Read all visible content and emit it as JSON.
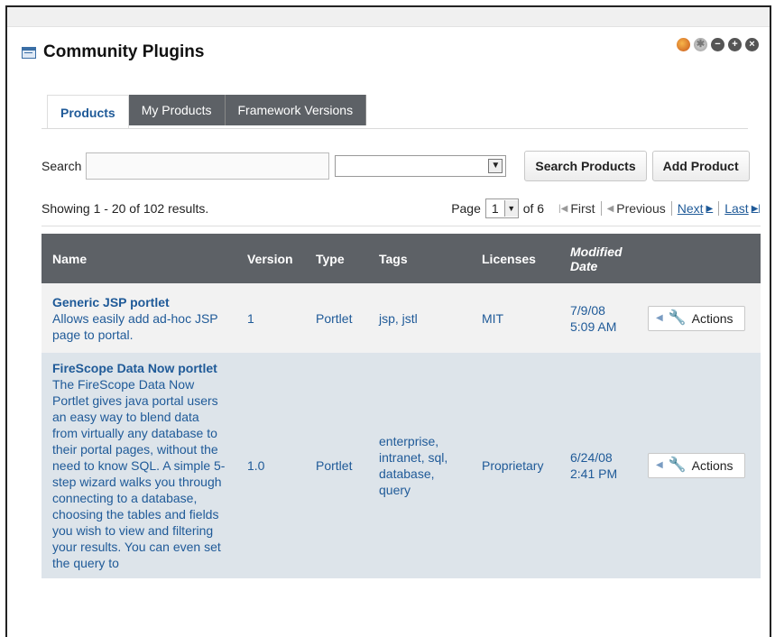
{
  "portlet": {
    "title": "Community Plugins",
    "title_icon": "portlet-list-icon",
    "window_icons": [
      "look-and-feel-icon",
      "configuration-icon",
      "minimize-icon",
      "maximize-icon",
      "close-icon"
    ]
  },
  "tabs": [
    {
      "label": "Products",
      "active": true
    },
    {
      "label": "My Products",
      "active": false
    },
    {
      "label": "Framework Versions",
      "active": false
    }
  ],
  "search": {
    "label": "Search",
    "value": "",
    "placeholder": "",
    "filter_value": "",
    "search_button": "Search Products",
    "add_button": "Add Product"
  },
  "results": {
    "showing": "Showing 1 - 20 of 102 results.",
    "page_label": "Page",
    "page_value": "1",
    "of_label": "of 6",
    "first": "First",
    "previous": "Previous",
    "next": "Next",
    "last": "Last"
  },
  "table": {
    "headers": {
      "name": "Name",
      "version": "Version",
      "type": "Type",
      "tags": "Tags",
      "licenses": "Licenses",
      "modified_1": "Modified",
      "modified_2": "Date"
    },
    "rows": [
      {
        "name": "Generic JSP portlet",
        "description": "Allows easily add ad-hoc JSP page to portal.",
        "version": "1",
        "type": "Portlet",
        "tags": "jsp, jstl",
        "licenses": "MIT",
        "modified_date": "7/9/08",
        "modified_time": "5:09 AM",
        "action": "Actions"
      },
      {
        "name": "FireScope Data Now portlet",
        "description": "The FireScope Data Now Portlet gives java portal users an easy way to blend data from virtually any database to their portal pages, without the need to know SQL. A simple 5-step wizard walks you through connecting to a database, choosing the tables and fields you wish to view and filtering your results. You can even set the query to",
        "version": "1.0",
        "type": "Portlet",
        "tags": "enterprise, intranet, sql, database, query",
        "licenses": "Proprietary",
        "modified_date": "6/24/08",
        "modified_time": "2:41 PM",
        "action": "Actions"
      }
    ]
  },
  "colors": {
    "header_bg": "#5d6166",
    "link": "#1f5a98",
    "row_alt": "#dde4ea"
  }
}
